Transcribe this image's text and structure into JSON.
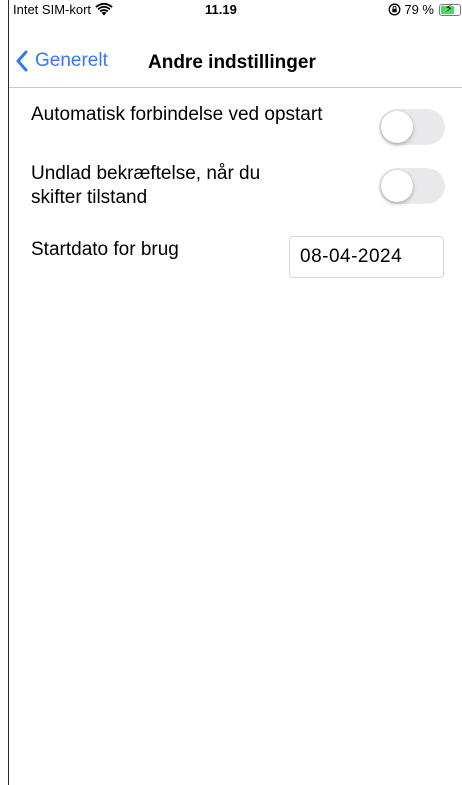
{
  "status_bar": {
    "carrier": "Intet SIM-kort",
    "time": "11.19",
    "battery_percent": "79 %",
    "battery_level": 0.79,
    "icons": [
      "wifi-icon",
      "orientation-lock-icon",
      "battery-charging-icon"
    ]
  },
  "nav": {
    "back_label": "Generelt",
    "title": "Andre indstillinger",
    "accent_color": "#3478f6"
  },
  "settings": {
    "auto_connect": {
      "label": "Automatisk forbindelse ved opstart",
      "enabled": false
    },
    "skip_confirmation": {
      "label_line1": "Undlad bekræftelse, når du",
      "label_line2": "skifter tilstand",
      "enabled": false
    },
    "start_date": {
      "label": "Startdato for brug",
      "value": "08-04-2024"
    }
  }
}
